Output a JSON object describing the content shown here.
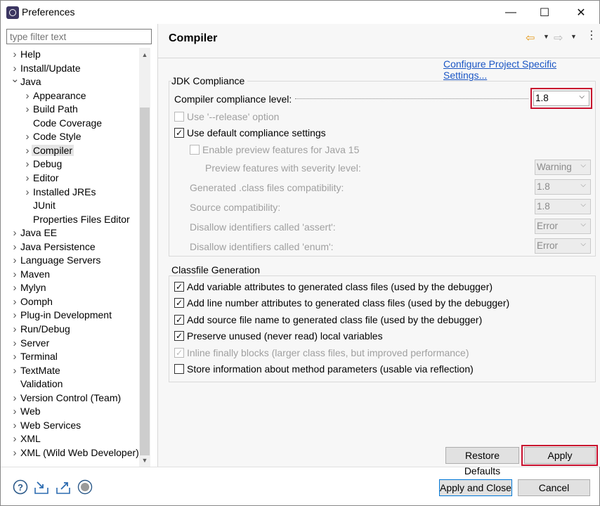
{
  "window": {
    "title": "Preferences",
    "controls": {
      "minimize": "—",
      "maximize": "☐",
      "close": "✕"
    }
  },
  "filter": {
    "placeholder": "type filter text",
    "value": ""
  },
  "tree": [
    {
      "label": "Help",
      "twisty": "collapsed",
      "level": 0
    },
    {
      "label": "Install/Update",
      "twisty": "collapsed",
      "level": 0
    },
    {
      "label": "Java",
      "twisty": "expanded",
      "level": 0
    },
    {
      "label": "Appearance",
      "twisty": "collapsed",
      "level": 1
    },
    {
      "label": "Build Path",
      "twisty": "collapsed",
      "level": 1
    },
    {
      "label": "Code Coverage",
      "twisty": "none",
      "level": 1
    },
    {
      "label": "Code Style",
      "twisty": "collapsed",
      "level": 1
    },
    {
      "label": "Compiler",
      "twisty": "collapsed",
      "level": 1,
      "selected": true
    },
    {
      "label": "Debug",
      "twisty": "collapsed",
      "level": 1
    },
    {
      "label": "Editor",
      "twisty": "collapsed",
      "level": 1
    },
    {
      "label": "Installed JREs",
      "twisty": "collapsed",
      "level": 1
    },
    {
      "label": "JUnit",
      "twisty": "none",
      "level": 1
    },
    {
      "label": "Properties Files Editor",
      "twisty": "none",
      "level": 1
    },
    {
      "label": "Java EE",
      "twisty": "collapsed",
      "level": 0
    },
    {
      "label": "Java Persistence",
      "twisty": "collapsed",
      "level": 0
    },
    {
      "label": "Language Servers",
      "twisty": "collapsed",
      "level": 0
    },
    {
      "label": "Maven",
      "twisty": "collapsed",
      "level": 0
    },
    {
      "label": "Mylyn",
      "twisty": "collapsed",
      "level": 0
    },
    {
      "label": "Oomph",
      "twisty": "collapsed",
      "level": 0
    },
    {
      "label": "Plug-in Development",
      "twisty": "collapsed",
      "level": 0
    },
    {
      "label": "Run/Debug",
      "twisty": "collapsed",
      "level": 0
    },
    {
      "label": "Server",
      "twisty": "collapsed",
      "level": 0
    },
    {
      "label": "Terminal",
      "twisty": "collapsed",
      "level": 0
    },
    {
      "label": "TextMate",
      "twisty": "collapsed",
      "level": 0
    },
    {
      "label": "Validation",
      "twisty": "none",
      "level": 0
    },
    {
      "label": "Version Control (Team)",
      "twisty": "collapsed",
      "level": 0
    },
    {
      "label": "Web",
      "twisty": "collapsed",
      "level": 0
    },
    {
      "label": "Web Services",
      "twisty": "collapsed",
      "level": 0
    },
    {
      "label": "XML",
      "twisty": "collapsed",
      "level": 0
    },
    {
      "label": "XML (Wild Web Developer)",
      "twisty": "collapsed",
      "level": 0
    }
  ],
  "page": {
    "title": "Compiler",
    "configure_link": "Configure Project Specific Settings...",
    "jdk": {
      "group_title": "JDK Compliance",
      "compliance_label": "Compiler compliance level:",
      "compliance_value": "1.8",
      "use_release": {
        "label": "Use '--release' option",
        "checked": false,
        "enabled": false
      },
      "use_default": {
        "label": "Use default compliance settings",
        "checked": true,
        "enabled": true
      },
      "enable_preview": {
        "label": "Enable preview features for Java 15",
        "checked": false,
        "enabled": false
      },
      "preview_severity": {
        "label": "Preview features with severity level:",
        "value": "Warning"
      },
      "generated_class": {
        "label": "Generated .class files compatibility:",
        "value": "1.8"
      },
      "source_compat": {
        "label": "Source compatibility:",
        "value": "1.8"
      },
      "disallow_assert": {
        "label": "Disallow identifiers called 'assert':",
        "value": "Error"
      },
      "disallow_enum": {
        "label": "Disallow identifiers called 'enum':",
        "value": "Error"
      }
    },
    "classfile": {
      "group_title": "Classfile Generation",
      "options": [
        {
          "label": "Add variable attributes to generated class files (used by the debugger)",
          "checked": true,
          "enabled": true
        },
        {
          "label": "Add line number attributes to generated class files (used by the debugger)",
          "checked": true,
          "enabled": true
        },
        {
          "label": "Add source file name to generated class file (used by the debugger)",
          "checked": true,
          "enabled": true
        },
        {
          "label": "Preserve unused (never read) local variables",
          "checked": true,
          "enabled": true
        },
        {
          "label": "Inline finally blocks (larger class files, but improved performance)",
          "checked": true,
          "enabled": false
        },
        {
          "label": "Store information about method parameters (usable via reflection)",
          "checked": false,
          "enabled": true
        }
      ]
    },
    "buttons": {
      "restore": "Restore Defaults",
      "apply": "Apply"
    }
  },
  "footer": {
    "apply_close": "Apply and Close",
    "cancel": "Cancel"
  },
  "icons": [
    "help-icon",
    "import-icon",
    "export-icon",
    "record-icon"
  ],
  "colors": {
    "highlight": "#c8102e",
    "link": "#1a55c4",
    "nav_back": "#e59a1c"
  }
}
